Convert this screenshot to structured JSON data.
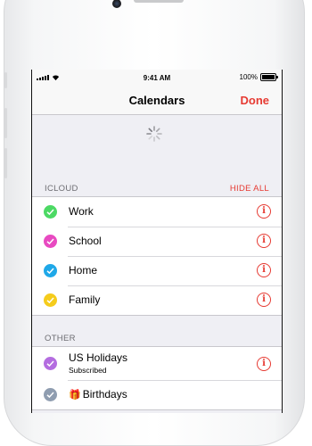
{
  "status_bar": {
    "time": "9:41 AM",
    "battery": "100%"
  },
  "nav": {
    "title": "Calendars",
    "done_label": "Done"
  },
  "icloud": {
    "header": "ICLOUD",
    "hide_all_label": "HIDE ALL",
    "items": [
      {
        "label": "Work",
        "color": "#4cd964"
      },
      {
        "label": "School",
        "color": "#e84ac1"
      },
      {
        "label": "Home",
        "color": "#1fa8e8"
      },
      {
        "label": "Family",
        "color": "#f5cc1c"
      }
    ]
  },
  "other": {
    "header": "OTHER",
    "items": [
      {
        "label": "US Holidays",
        "sublabel": "Subscribed",
        "color": "#b46de0"
      },
      {
        "label": "Birthdays",
        "color": "#8f9db0",
        "icon": "gift-icon"
      }
    ]
  },
  "colors": {
    "accent": "#e63a32"
  }
}
